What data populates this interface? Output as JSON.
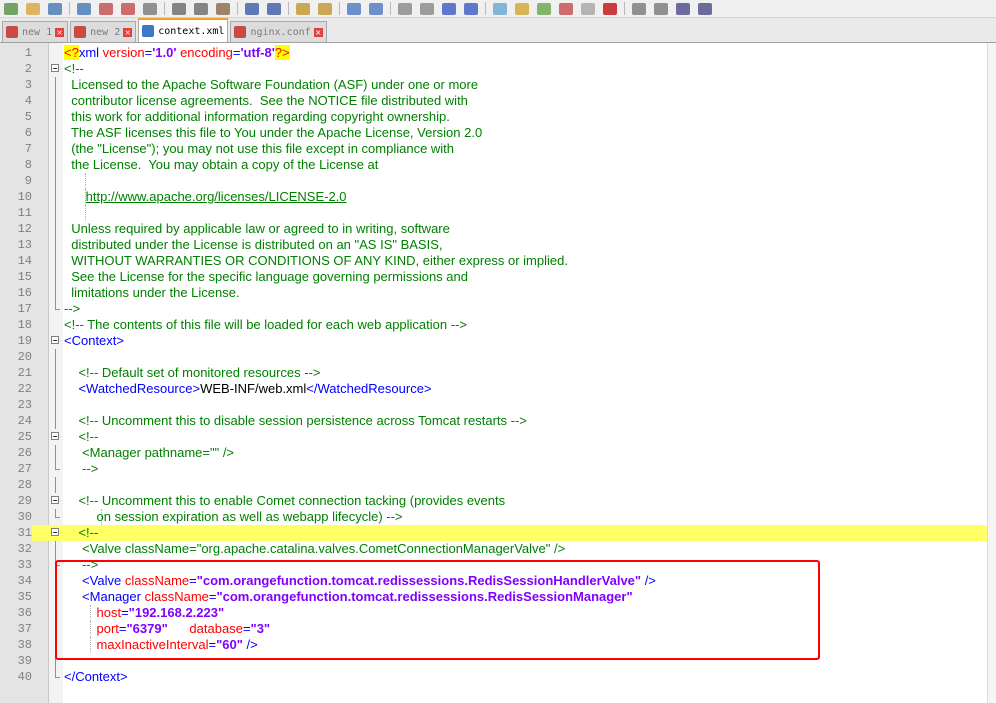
{
  "toolbar": {
    "buttons": [
      "new-file",
      "open-file",
      "save",
      "save-all",
      "close",
      "close-all",
      "print",
      "cut",
      "copy",
      "paste",
      "undo",
      "redo",
      "find",
      "replace",
      "zoom-in",
      "zoom-out",
      "sync-vertical",
      "sync-horizontal",
      "word-wrap",
      "show-all-chars",
      "indent-guide",
      "user-language",
      "doc-map",
      "function-list",
      "monitoring",
      "record-macro",
      "stop-recording",
      "playback-macro",
      "run-macro-multiple",
      "save-macro"
    ]
  },
  "tabs": [
    {
      "label": "new 1",
      "active": false
    },
    {
      "label": "new 2",
      "active": false
    },
    {
      "label": "context.xml",
      "active": true
    },
    {
      "label": "nginx.conf",
      "active": false
    }
  ],
  "editor": {
    "highlighted_line": 31,
    "lines": [
      {
        "n": "1",
        "fold": "none",
        "guides": [],
        "parts": [
          {
            "c": "pi",
            "t": "<?"
          },
          {
            "c": "tag",
            "t": "xml "
          },
          {
            "c": "attr",
            "t": "version"
          },
          {
            "c": "tag",
            "t": "="
          },
          {
            "c": "str",
            "t": "'1.0'"
          },
          {
            "c": "tag",
            "t": " "
          },
          {
            "c": "attr",
            "t": "encoding"
          },
          {
            "c": "tag",
            "t": "="
          },
          {
            "c": "str",
            "t": "'utf-8'"
          },
          {
            "c": "pi",
            "t": "?>"
          }
        ]
      },
      {
        "n": "2",
        "fold": "box",
        "guides": [],
        "parts": [
          {
            "c": "com",
            "t": "<!--"
          }
        ]
      },
      {
        "n": "3",
        "fold": "line",
        "guides": [],
        "parts": [
          {
            "c": "com",
            "t": "  Licensed to the Apache Software Foundation (ASF) under one or more"
          }
        ]
      },
      {
        "n": "4",
        "fold": "line",
        "guides": [],
        "parts": [
          {
            "c": "com",
            "t": "  contributor license agreements.  See the NOTICE file distributed with"
          }
        ]
      },
      {
        "n": "5",
        "fold": "line",
        "guides": [],
        "parts": [
          {
            "c": "com",
            "t": "  this work for additional information regarding copyright ownership."
          }
        ]
      },
      {
        "n": "6",
        "fold": "line",
        "guides": [],
        "parts": [
          {
            "c": "com",
            "t": "  The ASF licenses this file to You under the Apache License, Version 2.0"
          }
        ]
      },
      {
        "n": "7",
        "fold": "line",
        "guides": [],
        "parts": [
          {
            "c": "com",
            "t": "  (the \"License\"); you may not use this file except in compliance with"
          }
        ]
      },
      {
        "n": "8",
        "fold": "line",
        "guides": [],
        "parts": [
          {
            "c": "com",
            "t": "  the License.  You may obtain a copy of the License at"
          }
        ]
      },
      {
        "n": "9",
        "fold": "line",
        "guides": [
          85
        ],
        "parts": []
      },
      {
        "n": "10",
        "fold": "line",
        "guides": [
          85
        ],
        "parts": [
          {
            "c": "com",
            "t": "      "
          },
          {
            "c": "url",
            "t": "http://www.apache.org/licenses/LICENSE-2.0"
          }
        ]
      },
      {
        "n": "11",
        "fold": "line",
        "guides": [
          85
        ],
        "parts": []
      },
      {
        "n": "12",
        "fold": "line",
        "guides": [],
        "parts": [
          {
            "c": "com",
            "t": "  Unless required by applicable law or agreed to in writing, software"
          }
        ]
      },
      {
        "n": "13",
        "fold": "line",
        "guides": [],
        "parts": [
          {
            "c": "com",
            "t": "  distributed under the License is distributed on an \"AS IS\" BASIS,"
          }
        ]
      },
      {
        "n": "14",
        "fold": "line",
        "guides": [],
        "parts": [
          {
            "c": "com",
            "t": "  WITHOUT WARRANTIES OR CONDITIONS OF ANY KIND, either express or implied."
          }
        ]
      },
      {
        "n": "15",
        "fold": "line",
        "guides": [],
        "parts": [
          {
            "c": "com",
            "t": "  See the License for the specific language governing permissions and"
          }
        ]
      },
      {
        "n": "16",
        "fold": "line",
        "guides": [],
        "parts": [
          {
            "c": "com",
            "t": "  limitations under the License."
          }
        ]
      },
      {
        "n": "17",
        "fold": "end",
        "guides": [],
        "parts": [
          {
            "c": "com",
            "t": "-->"
          }
        ]
      },
      {
        "n": "18",
        "fold": "none",
        "guides": [],
        "parts": [
          {
            "c": "com",
            "t": "<!-- The contents of this file will be loaded for each web application -->"
          }
        ]
      },
      {
        "n": "19",
        "fold": "box",
        "guides": [],
        "parts": [
          {
            "c": "tag",
            "t": "<Context>"
          }
        ]
      },
      {
        "n": "20",
        "fold": "line",
        "guides": [],
        "parts": []
      },
      {
        "n": "21",
        "fold": "line",
        "guides": [],
        "parts": [
          {
            "c": "com",
            "t": "    <!-- Default set of monitored resources -->"
          }
        ]
      },
      {
        "n": "22",
        "fold": "line",
        "guides": [],
        "parts": [
          {
            "c": "tag",
            "t": "    <WatchedResource>"
          },
          {
            "c": "txt",
            "t": "WEB-INF/web.xml"
          },
          {
            "c": "tag",
            "t": "</WatchedResource>"
          }
        ]
      },
      {
        "n": "23",
        "fold": "line",
        "guides": [],
        "parts": []
      },
      {
        "n": "24",
        "fold": "line",
        "guides": [],
        "parts": [
          {
            "c": "com",
            "t": "    <!-- Uncomment this to disable session persistence across Tomcat restarts -->"
          }
        ]
      },
      {
        "n": "25",
        "fold": "box",
        "guides": [],
        "parts": [
          {
            "c": "com",
            "t": "    <!--"
          }
        ]
      },
      {
        "n": "26",
        "fold": "line",
        "guides": [],
        "parts": [
          {
            "c": "com",
            "t": "     <Manager pathname=\"\" />"
          }
        ]
      },
      {
        "n": "27",
        "fold": "end",
        "guides": [],
        "parts": [
          {
            "c": "com",
            "t": "     -->"
          }
        ]
      },
      {
        "n": "28",
        "fold": "line",
        "guides": [],
        "parts": []
      },
      {
        "n": "29",
        "fold": "box",
        "guides": [],
        "parts": [
          {
            "c": "com",
            "t": "    <!-- Uncomment this to enable Comet connection tacking (provides events"
          }
        ]
      },
      {
        "n": "30",
        "fold": "end",
        "guides": [
          101
        ],
        "parts": [
          {
            "c": "com",
            "t": "         on session expiration as well as webapp lifecycle) -->"
          }
        ]
      },
      {
        "n": "31",
        "fold": "box",
        "guides": [],
        "parts": [
          {
            "c": "com",
            "t": "    <!--"
          }
        ]
      },
      {
        "n": "32",
        "fold": "line",
        "guides": [],
        "parts": [
          {
            "c": "com",
            "t": "     <Valve className=\"org.apache.catalina.valves.CometConnectionManagerValve\" />"
          }
        ]
      },
      {
        "n": "33",
        "fold": "end",
        "guides": [],
        "parts": [
          {
            "c": "com",
            "t": "     -->"
          }
        ]
      },
      {
        "n": "34",
        "fold": "line",
        "guides": [],
        "parts": [
          {
            "c": "tag",
            "t": "     <Valve "
          },
          {
            "c": "attr",
            "t": "className"
          },
          {
            "c": "tag",
            "t": "="
          },
          {
            "c": "str",
            "t": "\"com.orangefunction.tomcat.redissessions.RedisSessionHandlerValve\""
          },
          {
            "c": "tag",
            "t": " />"
          }
        ]
      },
      {
        "n": "35",
        "fold": "line",
        "guides": [],
        "parts": [
          {
            "c": "tag",
            "t": "     <Manager "
          },
          {
            "c": "attr",
            "t": "className"
          },
          {
            "c": "tag",
            "t": "="
          },
          {
            "c": "str",
            "t": "\"com.orangefunction.tomcat.redissessions.RedisSessionManager\""
          }
        ]
      },
      {
        "n": "36",
        "fold": "line",
        "guides": [
          90
        ],
        "parts": [
          {
            "c": "attr",
            "t": "         host"
          },
          {
            "c": "tag",
            "t": "="
          },
          {
            "c": "str",
            "t": "\"192.168.2.223\""
          }
        ]
      },
      {
        "n": "37",
        "fold": "line",
        "guides": [
          90
        ],
        "parts": [
          {
            "c": "attr",
            "t": "         port"
          },
          {
            "c": "tag",
            "t": "="
          },
          {
            "c": "str",
            "t": "\"6379\""
          },
          {
            "c": "attr",
            "t": "      database"
          },
          {
            "c": "tag",
            "t": "="
          },
          {
            "c": "str",
            "t": "\"3\""
          }
        ]
      },
      {
        "n": "38",
        "fold": "line",
        "guides": [
          90
        ],
        "parts": [
          {
            "c": "attr",
            "t": "         maxInactiveInterval"
          },
          {
            "c": "tag",
            "t": "="
          },
          {
            "c": "str",
            "t": "\"60\""
          },
          {
            "c": "tag",
            "t": " />"
          }
        ]
      },
      {
        "n": "39",
        "fold": "line",
        "guides": [],
        "parts": []
      },
      {
        "n": "40",
        "fold": "end",
        "guides": [],
        "parts": [
          {
            "c": "tag",
            "t": "</Context>"
          }
        ]
      }
    ]
  },
  "colors": {
    "comment": "#008000",
    "tag": "#0000ff",
    "attribute": "#ff0000",
    "string": "#8000ff",
    "current_line": "#ffff66",
    "annotation_box": "#ff0000",
    "active_tab_accent": "#f4a020"
  }
}
